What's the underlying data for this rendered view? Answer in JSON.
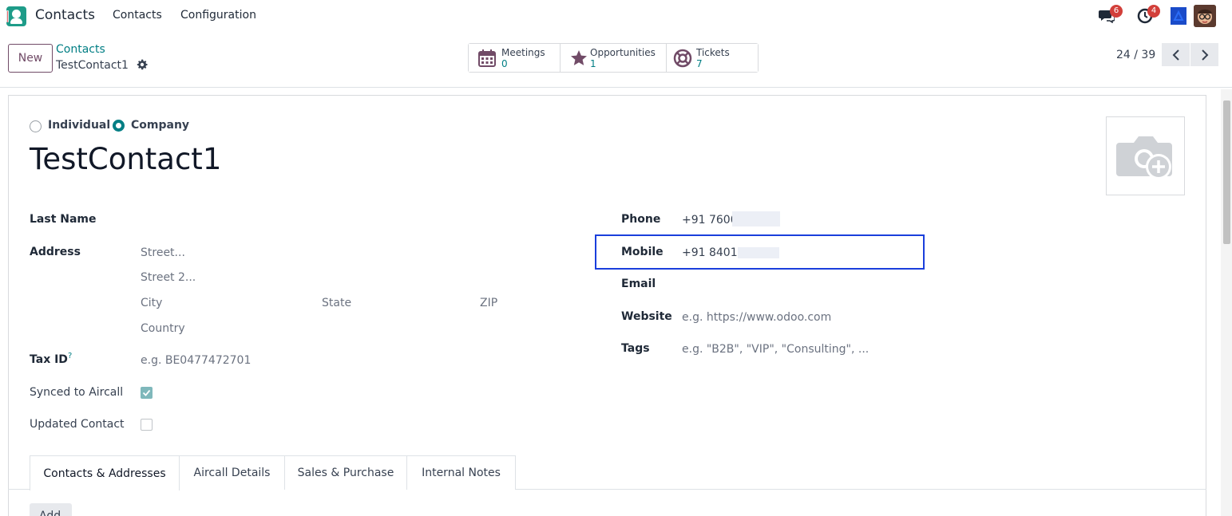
{
  "navbar": {
    "app_name": "Contacts",
    "menu": [
      "Contacts",
      "Configuration"
    ],
    "messages_badge": "6",
    "activities_badge": "4"
  },
  "control_panel": {
    "new_label": "New",
    "breadcrumb": "Contacts",
    "record_name": "TestContact1",
    "pager_value": "24 / 39",
    "smart_buttons": [
      {
        "label": "Meetings",
        "value": "0",
        "icon": "calendar-icon"
      },
      {
        "label": "Opportunities",
        "value": "1",
        "icon": "star-icon"
      },
      {
        "label": "Tickets",
        "value": "7",
        "icon": "lifebuoy-icon"
      }
    ]
  },
  "form": {
    "type_options": [
      "Individual",
      "Company"
    ],
    "type_selected": "Company",
    "name": "TestContact1",
    "left_labels": {
      "last_name": "Last Name",
      "address": "Address",
      "tax_id": "Tax ID",
      "synced": "Synced to Aircall",
      "updated": "Updated Contact"
    },
    "tax_id_help": "?",
    "address_placeholders": {
      "street": "Street...",
      "street2": "Street 2...",
      "city": "City",
      "state": "State",
      "zip": "ZIP",
      "country": "Country"
    },
    "tax_id_placeholder": "e.g. BE0477472701",
    "synced_checked": true,
    "updated_checked": false,
    "right_labels": {
      "phone": "Phone",
      "mobile": "Mobile",
      "email": "Email",
      "website": "Website",
      "tags": "Tags"
    },
    "phone_value": "+91 7600",
    "mobile_value": "+91 8401(",
    "website_placeholder": "e.g. https://www.odoo.com",
    "tags_placeholder": "e.g. \"B2B\", \"VIP\", \"Consulting\", ..."
  },
  "tabs": [
    "Contacts & Addresses",
    "Aircall Details",
    "Sales & Purchase",
    "Internal Notes"
  ],
  "active_tab": "Contacts & Addresses",
  "add_label": "Add",
  "colors": {
    "brand": "#714b67",
    "accent": "#017e84",
    "highlight": "#1a3fdc",
    "badge": "#d23f3a"
  }
}
